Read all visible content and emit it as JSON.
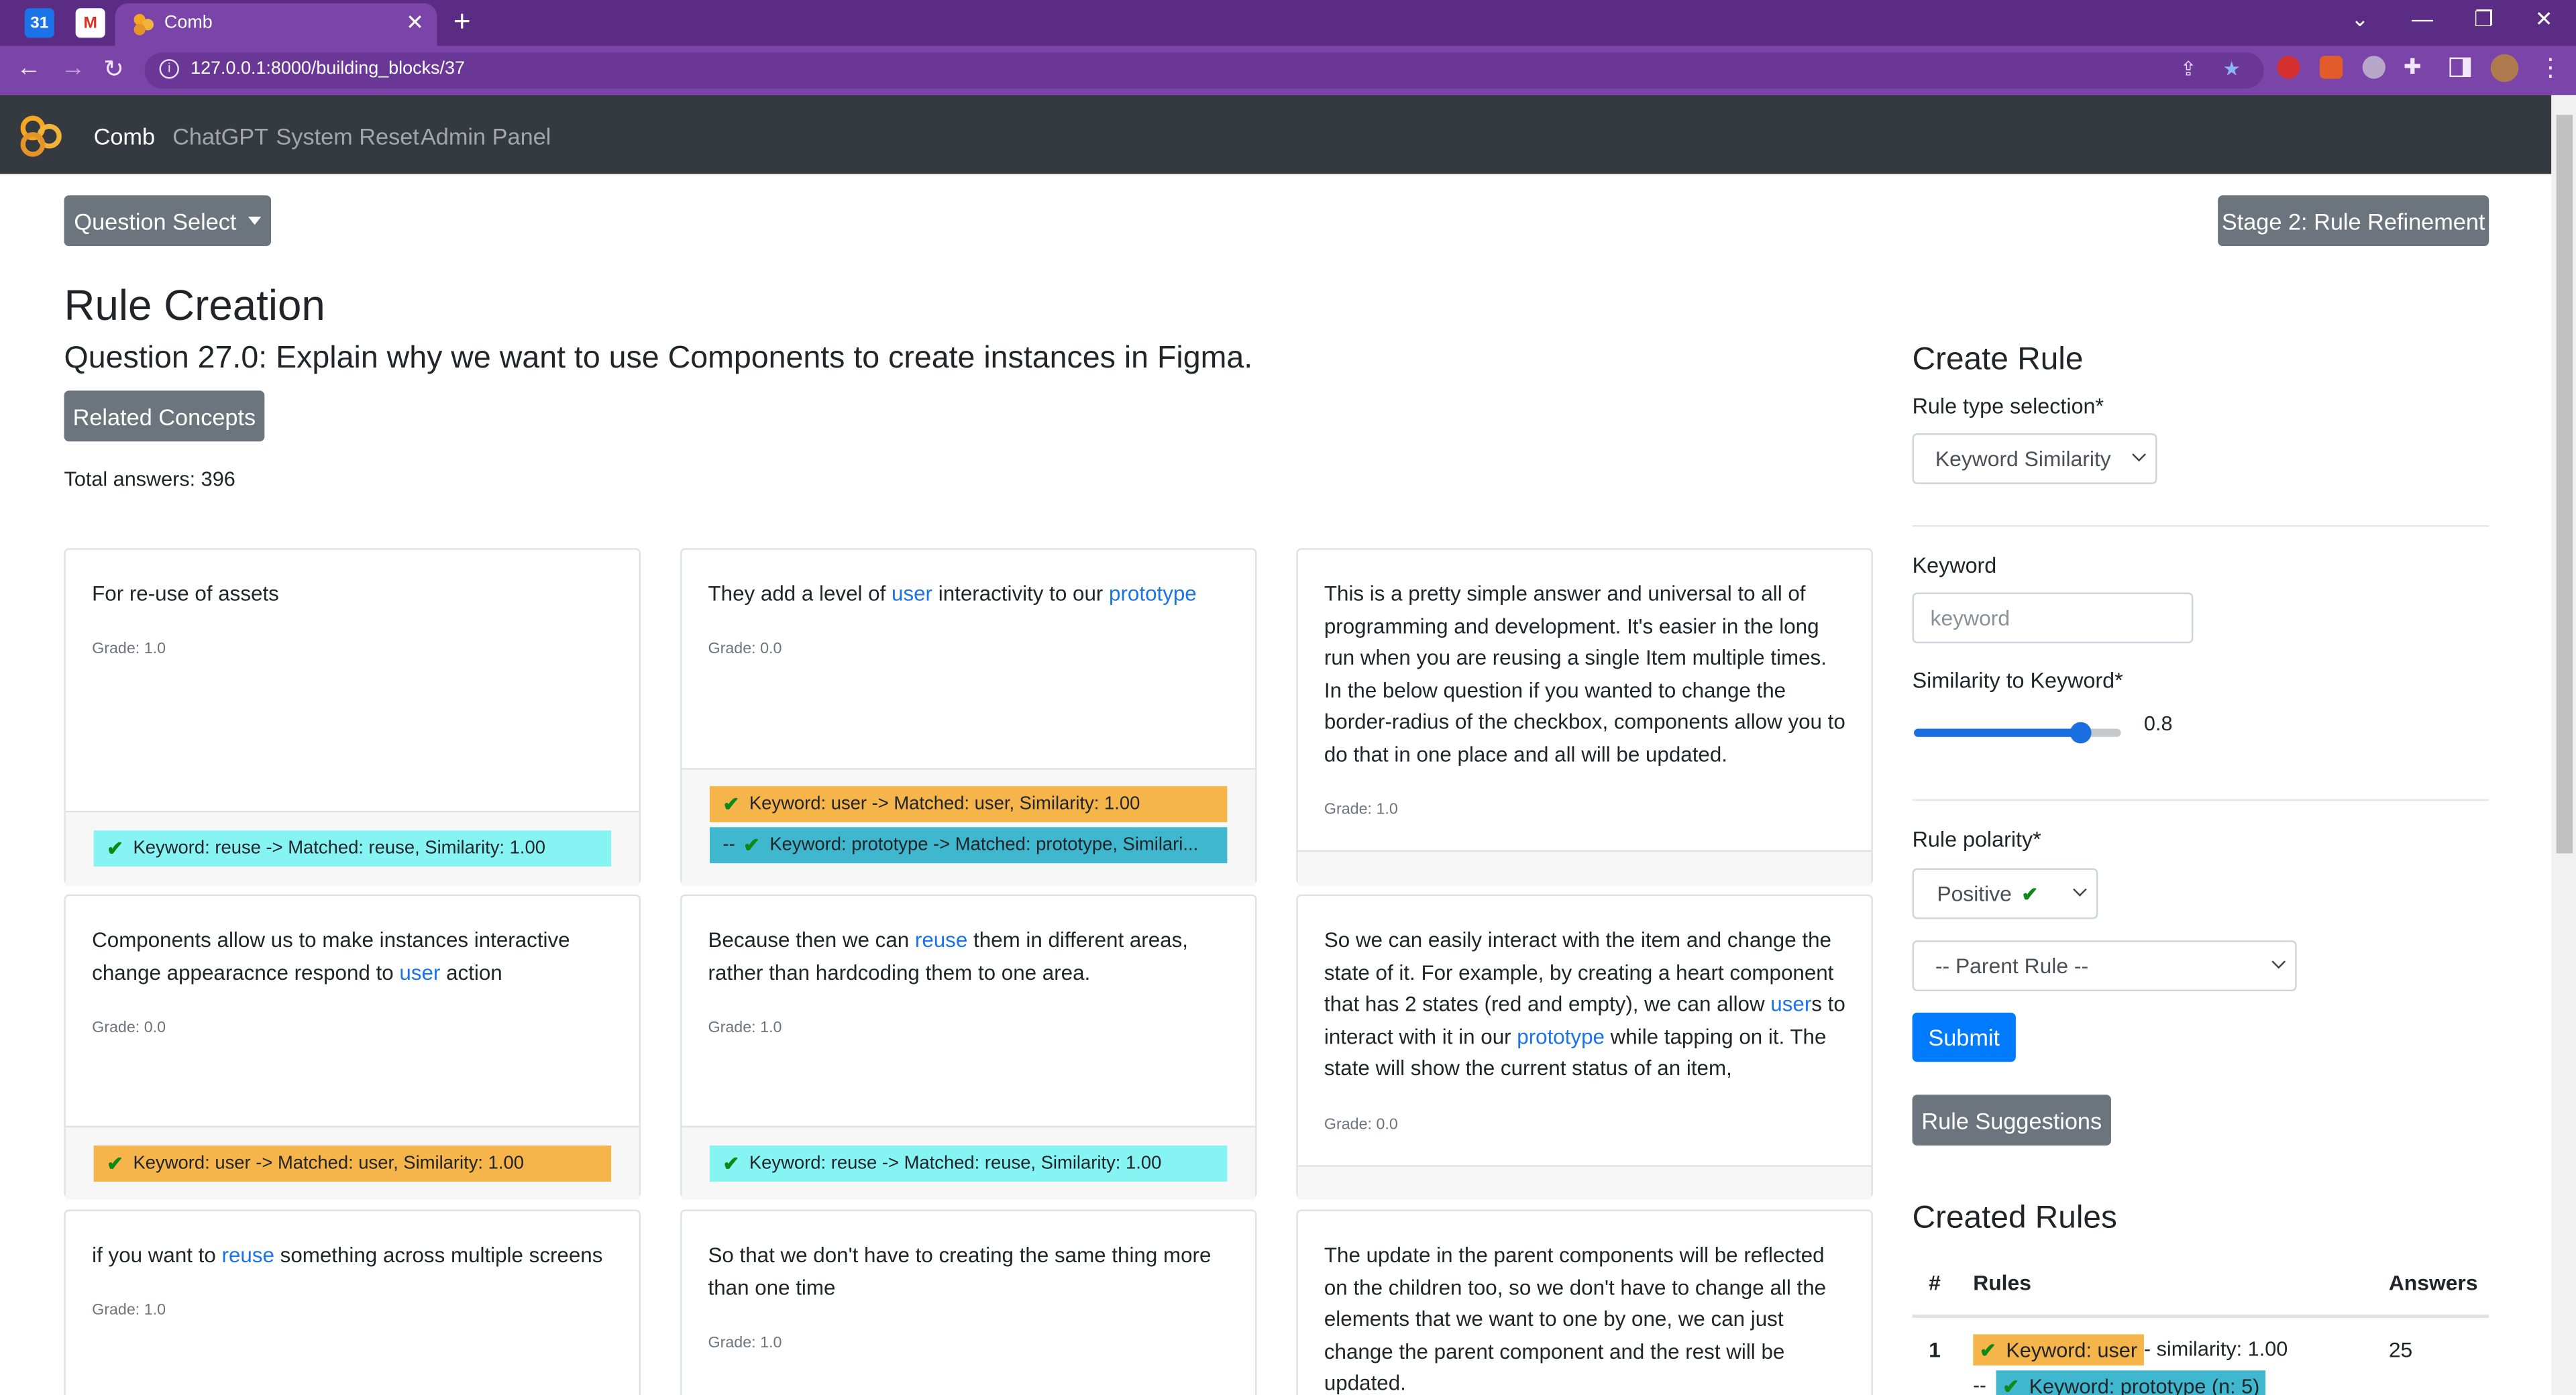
{
  "browser": {
    "tab_title": "Comb",
    "url": "127.0.0.1:8000/building_blocks/37"
  },
  "navbar": {
    "brand": "Comb",
    "links": [
      "ChatGPT",
      "System Reset",
      "Admin Panel"
    ]
  },
  "toolbar": {
    "question_select": "Question Select",
    "stage_button": "Stage 2: Rule Refinement"
  },
  "page": {
    "title": "Rule Creation",
    "question": "Question 27.0: Explain why we want to use Components to create instances in Figma.",
    "related_concepts": "Related Concepts",
    "total_answers": "Total answers: 396"
  },
  "answers": [
    {
      "parts": [
        {
          "t": "For re-use of assets",
          "k": false
        }
      ],
      "grade": "Grade: 1.0",
      "tags": [
        {
          "text": "Keyword: reuse -> Matched: reuse, Similarity: 1.00",
          "color": "#87f4f4"
        }
      ]
    },
    {
      "parts": [
        {
          "t": "They add a level of ",
          "k": false
        },
        {
          "t": "user",
          "k": true
        },
        {
          "t": " interactivity to our ",
          "k": false
        },
        {
          "t": "prototype",
          "k": true
        }
      ],
      "grade": "Grade: 0.0",
      "tags": [
        {
          "text": "Keyword: user -> Matched: user, Similarity: 1.00",
          "color": "#f5b54a"
        },
        {
          "text": "Keyword: prototype -> Matched: prototype, Similari...",
          "color": "#3fb8cf",
          "prefix": "--"
        }
      ]
    },
    {
      "parts": [
        {
          "t": "This is a pretty simple answer and universal to all of programming and development. It's easier in the long run when you are reusing a single Item multiple times. In the below question if you wanted to change the border-radius of the checkbox, components allow you to do that in one place and all will be updated.",
          "k": false
        }
      ],
      "grade": "Grade: 1.0",
      "tags": []
    },
    {
      "parts": [
        {
          "t": "Components allow us to make instances interactive change appearacnce respond to ",
          "k": false
        },
        {
          "t": "user",
          "k": true
        },
        {
          "t": " action",
          "k": false
        }
      ],
      "grade": "Grade: 0.0",
      "tags": [
        {
          "text": "Keyword: user -> Matched: user, Similarity: 1.00",
          "color": "#f5b54a"
        }
      ]
    },
    {
      "parts": [
        {
          "t": "Because then we can ",
          "k": false
        },
        {
          "t": "reuse",
          "k": true
        },
        {
          "t": " them in different areas, rather than hardcoding them to one area.",
          "k": false
        }
      ],
      "grade": "Grade: 1.0",
      "tags": [
        {
          "text": "Keyword: reuse -> Matched: reuse, Similarity: 1.00",
          "color": "#87f4f4"
        }
      ]
    },
    {
      "parts": [
        {
          "t": "So we can easily interact with the item and change the state of it. For example, by creating a heart component that has 2 states (red and empty), we can allow ",
          "k": false
        },
        {
          "t": "user",
          "k": true
        },
        {
          "t": "s to interact with it in our ",
          "k": false
        },
        {
          "t": "prototype",
          "k": true
        },
        {
          "t": " while tapping on it. The state will show the current status of an item,",
          "k": false
        }
      ],
      "grade": "Grade: 0.0",
      "tags": []
    },
    {
      "parts": [
        {
          "t": "if you want to ",
          "k": false
        },
        {
          "t": "reuse",
          "k": true
        },
        {
          "t": " something across multiple screens",
          "k": false
        }
      ],
      "grade": "Grade: 1.0",
      "tags": []
    },
    {
      "parts": [
        {
          "t": "So that we don't have to creating the same thing more than one time",
          "k": false
        }
      ],
      "grade": "Grade: 1.0",
      "tags": []
    },
    {
      "parts": [
        {
          "t": "The update in the parent components will be reflected on the children too, so we don't have to change all the elements that we want to one by one, we can just change the parent component and the rest will be updated.",
          "k": false
        }
      ],
      "grade": "",
      "tags": []
    }
  ],
  "create_rule": {
    "heading": "Create Rule",
    "type_label": "Rule type selection*",
    "type_value": "Keyword Similarity",
    "keyword_label": "Keyword",
    "keyword_placeholder": "keyword",
    "similarity_label": "Similarity to Keyword*",
    "similarity_value": "0.8",
    "similarity_fraction": 0.8,
    "polarity_label": "Rule polarity*",
    "polarity_value": "Positive",
    "parent_rule": "-- Parent Rule --",
    "submit": "Submit",
    "suggestions": "Rule Suggestions"
  },
  "created_rules": {
    "heading": "Created Rules",
    "columns": [
      "#",
      "Rules",
      "Answers"
    ],
    "rows": [
      {
        "num": "1",
        "tag": "Keyword: user",
        "rest": " - similarity: 1.00",
        "answers": "25",
        "child": "Keyword: prototype (n: 5)"
      }
    ]
  },
  "colors": {
    "chrome_dark": "#5b2c83",
    "chrome_light": "#7a44a8",
    "navbar": "#343a40",
    "cyan_tag": "#87f4f4",
    "orange_tag": "#f5b54a",
    "teal_tag": "#3fb8cf",
    "link": "#1a73e8"
  },
  "icons": [
    "calendar-icon",
    "gmail-icon",
    "comb-logo-icon",
    "close-icon",
    "plus-icon",
    "back-icon",
    "forward-icon",
    "reload-icon",
    "share-icon",
    "star-icon",
    "extensions-icon",
    "sidepanel-icon",
    "avatar",
    "menu-icon",
    "check-icon"
  ]
}
